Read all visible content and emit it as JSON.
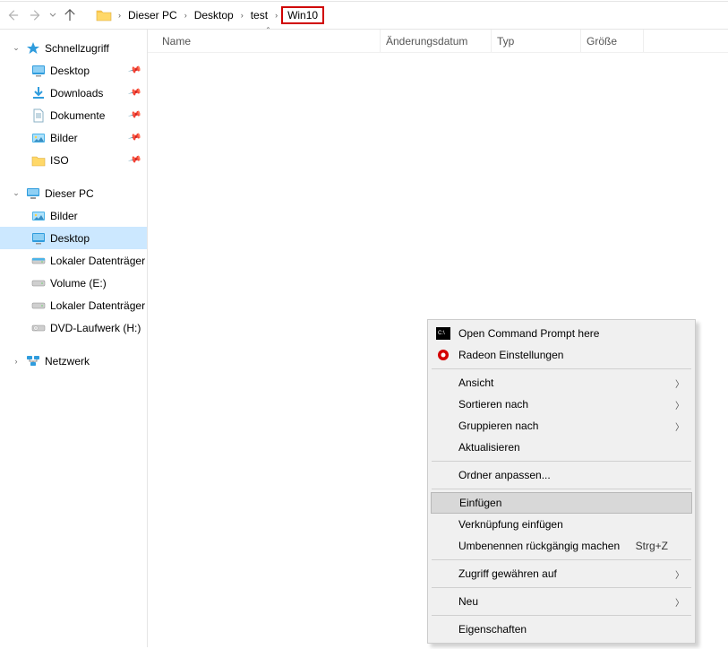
{
  "nav": {
    "back_disabled": true,
    "forward_disabled": true
  },
  "breadcrumbs": {
    "items": [
      {
        "label": "Dieser PC"
      },
      {
        "label": "Desktop"
      },
      {
        "label": "test"
      },
      {
        "label": "Win10",
        "highlighted": true
      }
    ]
  },
  "columns": {
    "name": "Name",
    "modified": "Änderungsdatum",
    "type": "Typ",
    "size": "Größe"
  },
  "sidebar": {
    "quick_access": "Schnellzugriff",
    "quick_items": [
      {
        "label": "Desktop",
        "icon": "desktop",
        "pinned": true
      },
      {
        "label": "Downloads",
        "icon": "download",
        "pinned": true
      },
      {
        "label": "Dokumente",
        "icon": "document",
        "pinned": true
      },
      {
        "label": "Bilder",
        "icon": "pictures",
        "pinned": true
      },
      {
        "label": "ISO",
        "icon": "folder",
        "pinned": true
      }
    ],
    "this_pc": "Dieser PC",
    "pc_items": [
      {
        "label": "Bilder",
        "icon": "pictures",
        "selected": false
      },
      {
        "label": "Desktop",
        "icon": "desktop",
        "selected": true
      },
      {
        "label": "Lokaler Datenträger",
        "icon": "drive",
        "selected": false
      },
      {
        "label": "Volume (E:)",
        "icon": "drive",
        "selected": false
      },
      {
        "label": "Lokaler Datenträger",
        "icon": "drive",
        "selected": false
      },
      {
        "label": "DVD-Laufwerk (H:)",
        "icon": "dvd",
        "selected": false
      }
    ],
    "network": "Netzwerk"
  },
  "context_menu": {
    "items": [
      {
        "label": "Open Command Prompt here",
        "icon": "cmd"
      },
      {
        "label": "Radeon Einstellungen",
        "icon": "radeon"
      },
      {
        "type": "sep"
      },
      {
        "label": "Ansicht",
        "submenu": true
      },
      {
        "label": "Sortieren nach",
        "submenu": true
      },
      {
        "label": "Gruppieren nach",
        "submenu": true
      },
      {
        "label": "Aktualisieren"
      },
      {
        "type": "sep"
      },
      {
        "label": "Ordner anpassen..."
      },
      {
        "type": "sep"
      },
      {
        "label": "Einfügen",
        "highlight": true
      },
      {
        "label": "Verknüpfung einfügen"
      },
      {
        "label": "Umbenennen rückgängig machen",
        "shortcut": "Strg+Z"
      },
      {
        "type": "sep"
      },
      {
        "label": "Zugriff gewähren auf",
        "submenu": true
      },
      {
        "type": "sep"
      },
      {
        "label": "Neu",
        "submenu": true
      },
      {
        "type": "sep"
      },
      {
        "label": "Eigenschaften"
      }
    ]
  }
}
